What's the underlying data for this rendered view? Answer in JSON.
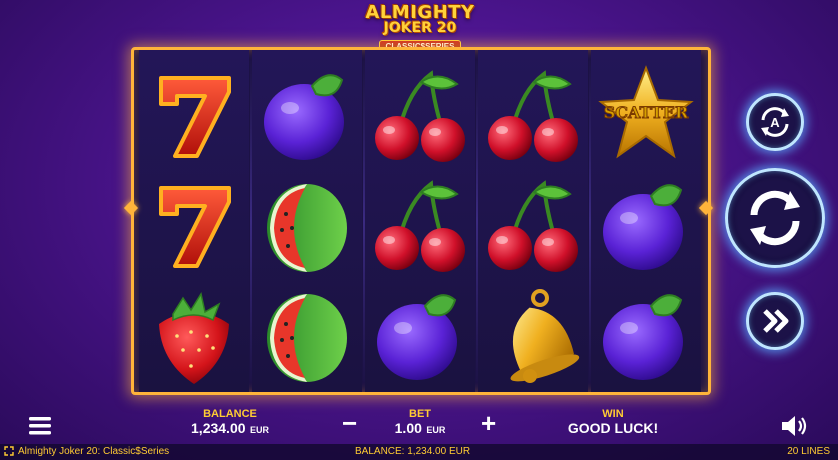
{
  "logo": {
    "line1": "ALMIGHTY",
    "line2": "JOKER 20",
    "line3": "CLASSIC$SERIES"
  },
  "reels": [
    [
      "seven",
      "seven",
      "strawberry"
    ],
    [
      "plum",
      "watermelon",
      "watermelon"
    ],
    [
      "cherry",
      "cherry",
      "plum"
    ],
    [
      "cherry",
      "cherry",
      "bell"
    ],
    [
      "scatter",
      "plum",
      "plum"
    ]
  ],
  "scatter_text": "SCATTER",
  "hud": {
    "balance_label": "BALANCE",
    "balance_value": "1,234.00",
    "balance_unit": "EUR",
    "bet_label": "BET",
    "bet_value": "1.00",
    "bet_unit": "EUR",
    "win_label": "WIN",
    "win_value": "GOOD LUCK!",
    "minus": "−",
    "plus": "+"
  },
  "status": {
    "game_title": "Almighty Joker 20: Classic$Series",
    "balance_text": "BALANCE: 1,234.00 EUR",
    "lines": "20 LINES"
  },
  "icons": {
    "menu": "menu-icon",
    "sound": "speaker-icon",
    "autoplay": "autoplay-icon",
    "spin": "spin-icon",
    "turbo": "fast-forward-icon"
  }
}
